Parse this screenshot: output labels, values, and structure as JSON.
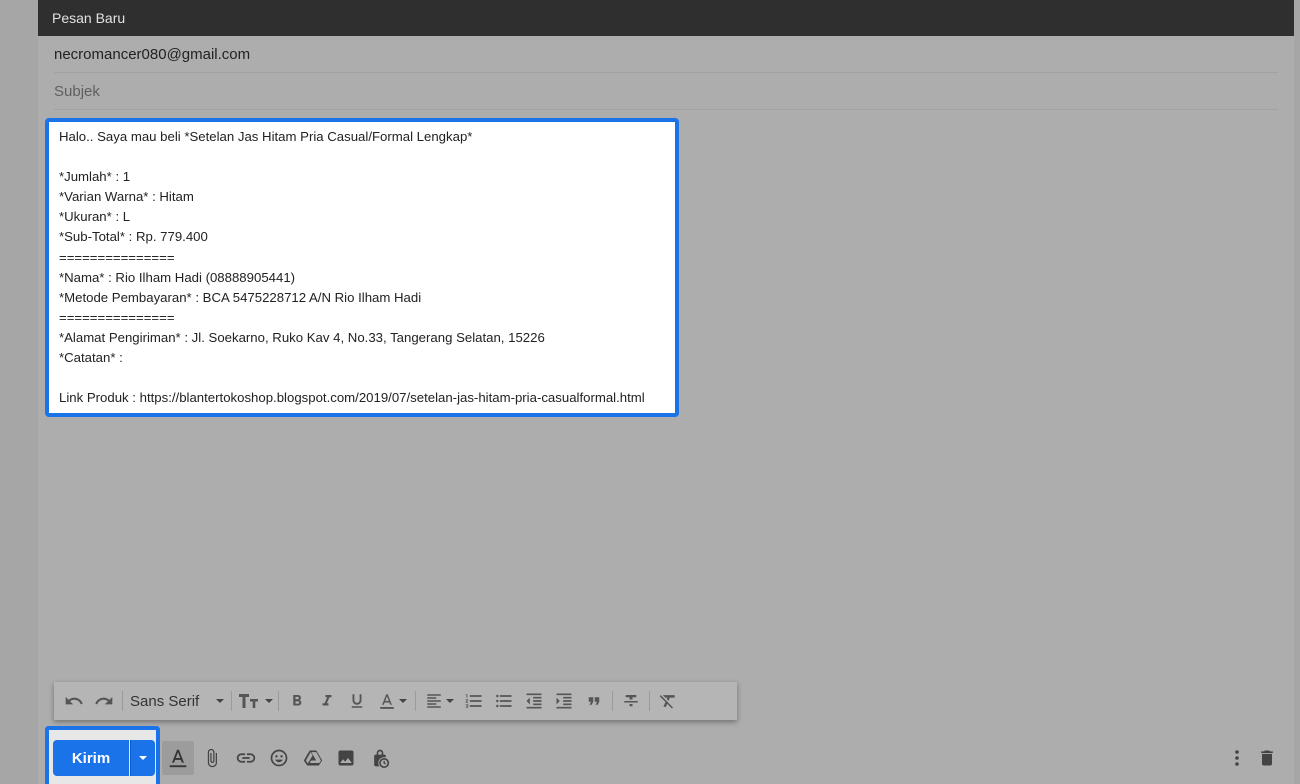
{
  "window": {
    "title": "Pesan Baru"
  },
  "compose": {
    "to": "necromancer080@gmail.com",
    "subject_placeholder": "Subjek",
    "body_lines": [
      "Halo.. Saya mau beli *Setelan Jas Hitam Pria Casual/Formal Lengkap*",
      "",
      "*Jumlah* : 1",
      "*Varian Warna* : Hitam",
      "*Ukuran* : L",
      "*Sub-Total* : Rp. 779.400",
      "===============",
      "*Nama* : Rio Ilham Hadi (08888905441)",
      "*Metode Pembayaran* : BCA 5475228712 A/N Rio Ilham Hadi",
      "===============",
      "*Alamat Pengiriman* : Jl. Soekarno, Ruko Kav 4, No.33, Tangerang Selatan, 15226",
      "*Catatan* :",
      "",
      "Link Produk : https://blantertokoshop.blogspot.com/2019/07/setelan-jas-hitam-pria-casualformal.html"
    ]
  },
  "toolbar": {
    "font": "Sans Serif",
    "icons": [
      "undo-icon",
      "redo-icon",
      "text-size-icon",
      "bold-icon",
      "italic-icon",
      "underline-icon",
      "text-color-icon",
      "align-icon",
      "numbered-list-icon",
      "bulleted-list-icon",
      "indent-less-icon",
      "indent-more-icon",
      "quote-icon",
      "strikethrough-icon",
      "clear-formatting-icon"
    ]
  },
  "actions": {
    "send_label": "Kirim",
    "icons": [
      "formatting-options-icon",
      "attach-icon",
      "link-icon",
      "emoji-icon",
      "drive-icon",
      "photo-icon",
      "confidential-icon",
      "more-options-icon",
      "discard-icon"
    ]
  },
  "colors": {
    "accent": "#1a73e8",
    "titlebar": "#2f2f2f",
    "overlay": "#adadad"
  }
}
